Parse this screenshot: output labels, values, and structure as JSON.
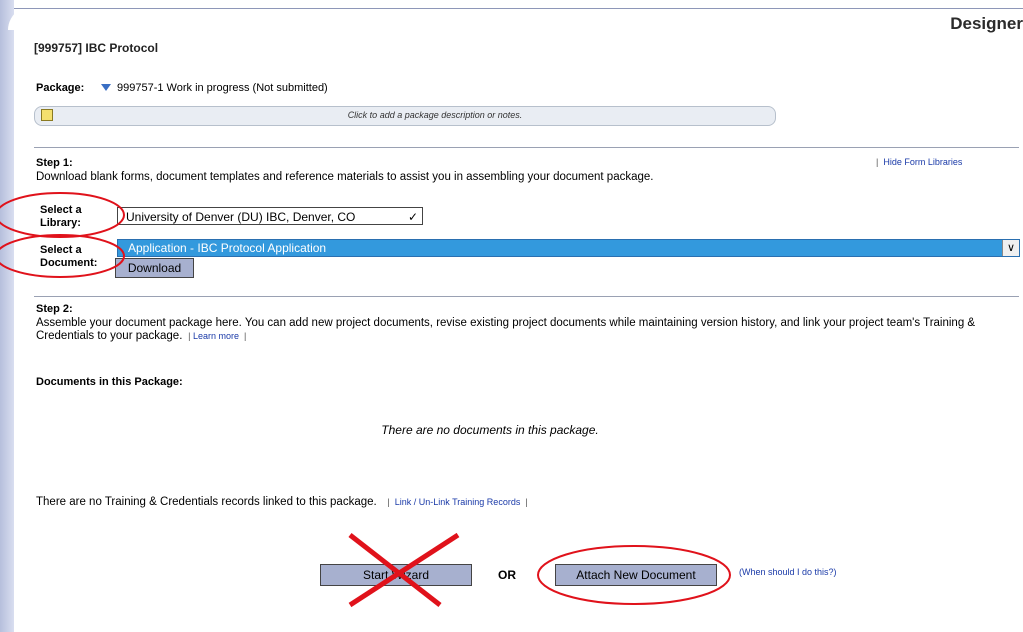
{
  "header": {
    "title": "Designer"
  },
  "protocol": {
    "title": "[999757] IBC Protocol"
  },
  "package": {
    "label": "Package:",
    "value": "999757-1  Work in progress (Not submitted)",
    "note_prompt": "Click to add a package description or notes."
  },
  "step1": {
    "heading": "Step 1:",
    "description": "Download blank forms, document templates and reference materials to assist you in assembling your document package.",
    "hide_link": "Hide Form Libraries",
    "library_label_1": "Select a",
    "library_label_2": "Library:",
    "library_value": "University of Denver (DU) IBC, Denver, CO",
    "document_label_1": "Select a",
    "document_label_2": "Document:",
    "document_value": "Application - IBC Protocol Application",
    "download_label": "Download"
  },
  "step2": {
    "heading": "Step 2:",
    "description": "Assemble your document package here. You can add new project documents, revise existing project documents while maintaining version history, and link your project team's Training & Credentials to your package.",
    "learn_more": "Learn more",
    "documents_heading": "Documents in this Package:",
    "no_documents": "There are no documents in this package.",
    "training_text": "There are no Training & Credentials records linked to this package.",
    "training_link": "Link / Un-Link Training Records"
  },
  "actions": {
    "start_wizard": "Start Wizard",
    "or": "OR",
    "attach_new": "Attach New Document",
    "when_link": "(When should I do this?)"
  },
  "annotations": {
    "color": "#e0121b"
  }
}
